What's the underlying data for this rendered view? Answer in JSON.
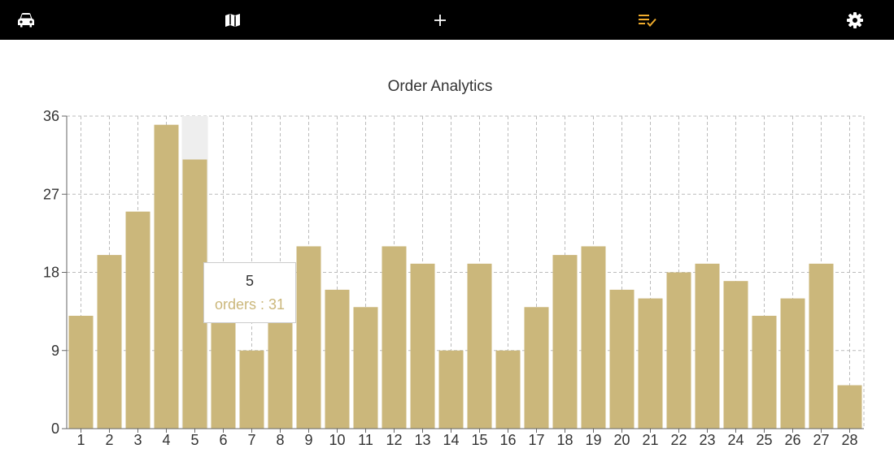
{
  "topbar": {
    "items": [
      {
        "name": "car-icon",
        "active": false
      },
      {
        "name": "map-icon",
        "active": false
      },
      {
        "name": "plus-icon",
        "active": false
      },
      {
        "name": "checklist-icon",
        "active": true
      },
      {
        "name": "gear-icon",
        "active": false
      }
    ],
    "icon_color": "#ffffff",
    "active_color": "#f0ac2c",
    "background": "#000000"
  },
  "chart_data": {
    "type": "bar",
    "title": "Order Analytics",
    "xlabel": "",
    "ylabel": "",
    "categories": [
      "1",
      "2",
      "3",
      "4",
      "5",
      "6",
      "7",
      "8",
      "9",
      "10",
      "11",
      "12",
      "13",
      "14",
      "15",
      "16",
      "17",
      "18",
      "19",
      "20",
      "21",
      "22",
      "23",
      "24",
      "25",
      "26",
      "27",
      "28"
    ],
    "series": [
      {
        "values": [
          13,
          20,
          25,
          35,
          31,
          17,
          9,
          15,
          21,
          16,
          14,
          21,
          19,
          9,
          19,
          9,
          14,
          20,
          21,
          16,
          15,
          18,
          19,
          17,
          13,
          15,
          19,
          5
        ]
      }
    ],
    "ylim": [
      0,
      36
    ],
    "yticks": [
      0,
      9,
      18,
      27,
      36
    ],
    "grid": true,
    "legend": "none",
    "bar_color": "#cbb77b",
    "highlight_index": 4
  },
  "tooltip": {
    "label": "5",
    "value_text": "orders : 31",
    "value_color": "#cbb77b"
  }
}
